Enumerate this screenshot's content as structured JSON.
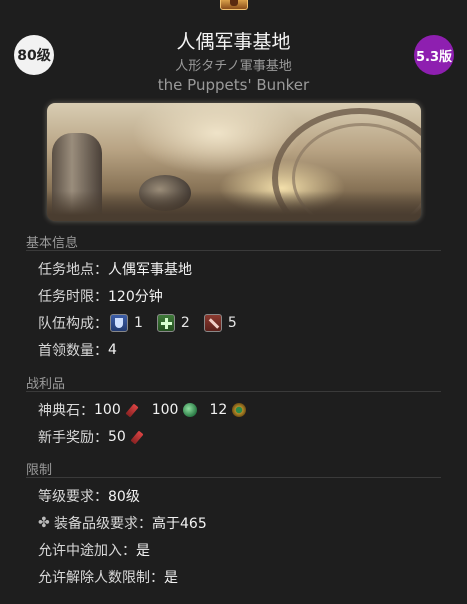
{
  "header": {
    "level": "80级",
    "patch": "5.3版",
    "title": "人偶军事基地",
    "subtitle_jp": "人形タチノ軍事基地",
    "subtitle_en": "the Puppets' Bunker"
  },
  "sections": {
    "basic": {
      "header": "基本信息",
      "location_label": "任务地点：",
      "location_value": "人偶军事基地",
      "time_label": "任务时限：",
      "time_value": "120分钟",
      "party_label": "队伍构成：",
      "party": [
        {
          "role": "tank-icon",
          "count": "1"
        },
        {
          "role": "healer-icon",
          "count": "2"
        },
        {
          "role": "dps-icon",
          "count": "5"
        }
      ],
      "boss_label": "首领数量：",
      "boss_value": "4"
    },
    "loot": {
      "header": "战利品",
      "tome_label": "神典石：",
      "tomes": [
        {
          "value": "100",
          "icon": "red-tomestone-icon"
        },
        {
          "value": "100",
          "icon": "green-tomestone-icon"
        },
        {
          "value": "12",
          "icon": "gold-tomestone-icon"
        }
      ],
      "novice_label": "新手奖励：",
      "novice_value": "50"
    },
    "limits": {
      "header": "限制",
      "level_label": "等级要求：",
      "level_value": "80级",
      "ilvl_label": "装备品级要求：",
      "ilvl_value": "高于465",
      "join_label": "允许中途加入：",
      "join_value": "是",
      "unrestricted_label": "允许解除人数限制：",
      "unrestricted_value": "是"
    }
  },
  "colors": {
    "background": "#1e1e1e",
    "patch_badge": "#8e1fb0",
    "level_badge": "#f2f2f2"
  }
}
